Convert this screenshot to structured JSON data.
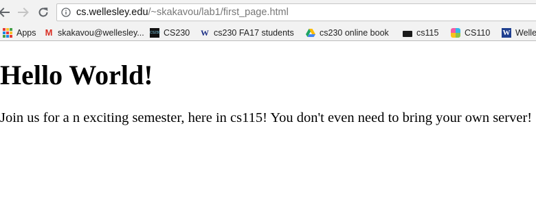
{
  "browser": {
    "url_host": "cs.wellesley.edu",
    "url_path": "/~skakavou/lab1/first_page.html",
    "icons": {
      "back": "arrow-left-icon",
      "forward": "arrow-right-icon",
      "reload": "reload-icon",
      "info": "info-circle-icon"
    }
  },
  "bookmarks": [
    {
      "label": "Apps",
      "icon": "apps-grid-icon"
    },
    {
      "label": "skakavou@wellesley...",
      "icon": "gmail-icon"
    },
    {
      "label": "CS230",
      "icon": "cs230-icon"
    },
    {
      "label": "cs230 FA17 students",
      "icon": "wellesley-w-icon"
    },
    {
      "label": "cs230 online book",
      "icon": "drive-icon"
    },
    {
      "label": "cs115",
      "icon": "cs115-icon"
    },
    {
      "label": "CS110",
      "icon": "cs110-icon"
    },
    {
      "label": "Welle",
      "icon": "wellesley-icon"
    }
  ],
  "page": {
    "heading": "Hello World!",
    "paragraph": "Join us for a n exciting semester, here in cs115! You don't even need to bring your own server!"
  },
  "colors": {
    "toolbar_bg": "#f2f2f2",
    "url_host": "#111111",
    "url_path": "#777777",
    "page_bg": "#ffffff",
    "text": "#000000"
  }
}
